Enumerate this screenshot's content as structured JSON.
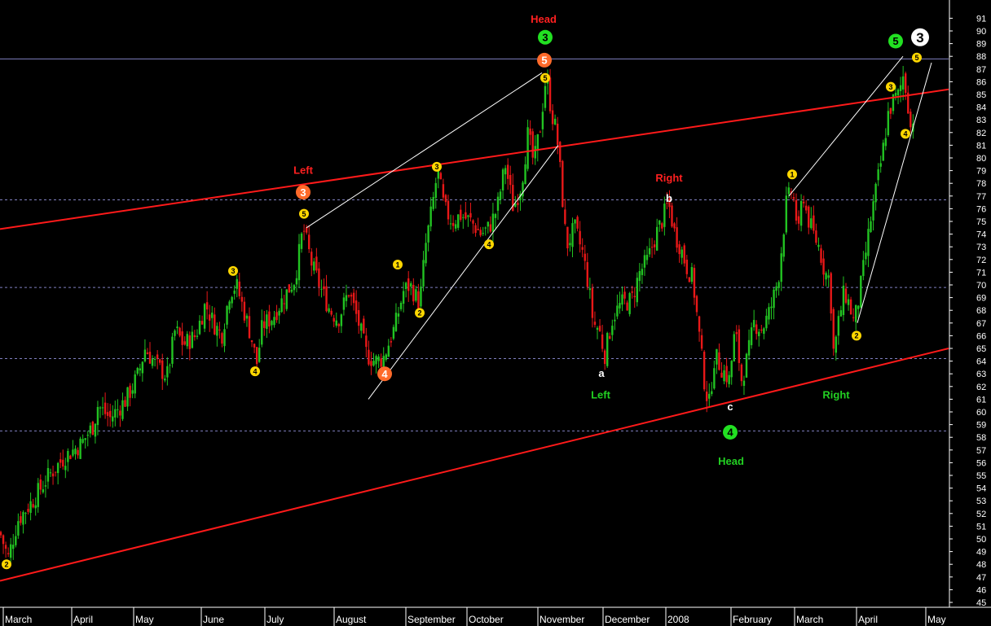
{
  "chart_data": {
    "type": "candlestick",
    "title": "",
    "xlabel": "",
    "ylabel": "",
    "ylim": [
      45,
      92
    ],
    "y_ticks": [
      45,
      46,
      47,
      48,
      49,
      50,
      51,
      52,
      53,
      54,
      55,
      56,
      57,
      58,
      59,
      60,
      61,
      62,
      63,
      64,
      65,
      66,
      67,
      68,
      69,
      70,
      71,
      72,
      73,
      74,
      75,
      76,
      77,
      78,
      79,
      80,
      81,
      82,
      83,
      84,
      85,
      86,
      87,
      88,
      89,
      90,
      91
    ],
    "x_ticks": [
      "March",
      "April",
      "May",
      "June",
      "July",
      "August",
      "September",
      "October",
      "November",
      "December",
      "2008",
      "February",
      "March",
      "April",
      "May"
    ],
    "grid": false,
    "reference_lines": [
      {
        "style": "dashed",
        "color": "#8080c0",
        "y": 58.5
      },
      {
        "style": "dashed",
        "color": "#8080c0",
        "y": 64.2
      },
      {
        "style": "dashed",
        "color": "#8080c0",
        "y": 69.8
      },
      {
        "style": "dashed",
        "color": "#8080c0",
        "y": 76.7
      },
      {
        "style": "solid",
        "color": "#8080c0",
        "y": 87.8
      }
    ],
    "colors": {
      "up": "#22c322",
      "down": "#e81818",
      "trend": "#ff1a1a",
      "wave": "#ffffff",
      "head": "#ff2020",
      "green_label": "#22d022",
      "yellow_marker": "#ffd700",
      "orange_marker": "#ff6a2a",
      "green_marker": "#22e022"
    },
    "price_path": [
      [
        0,
        50.5
      ],
      [
        10,
        48.5
      ],
      [
        22,
        51.5
      ],
      [
        40,
        53.0
      ],
      [
        60,
        55.0
      ],
      [
        80,
        56.5
      ],
      [
        100,
        57.5
      ],
      [
        115,
        59.0
      ],
      [
        120,
        60.5
      ],
      [
        135,
        59.5
      ],
      [
        155,
        61.0
      ],
      [
        170,
        63.0
      ],
      [
        178,
        65.0
      ],
      [
        190,
        63.8
      ],
      [
        205,
        62.8
      ],
      [
        215,
        66.5
      ],
      [
        225,
        65.3
      ],
      [
        240,
        66.0
      ],
      [
        252,
        68.5
      ],
      [
        262,
        67.0
      ],
      [
        272,
        66.0
      ],
      [
        282,
        69.5
      ],
      [
        290,
        70.0
      ],
      [
        300,
        67.8
      ],
      [
        308,
        66.0
      ],
      [
        315,
        63.8
      ],
      [
        322,
        66.8
      ],
      [
        335,
        67.5
      ],
      [
        348,
        69.0
      ],
      [
        362,
        70.5
      ],
      [
        372,
        74.5
      ],
      [
        383,
        71.5
      ],
      [
        395,
        69.5
      ],
      [
        405,
        68.0
      ],
      [
        415,
        67.3
      ],
      [
        428,
        69.5
      ],
      [
        440,
        67.0
      ],
      [
        450,
        64.5
      ],
      [
        460,
        64.0
      ],
      [
        470,
        64.2
      ],
      [
        485,
        66.8
      ],
      [
        495,
        69.5
      ],
      [
        503,
        70.0
      ],
      [
        515,
        68.5
      ],
      [
        522,
        73.0
      ],
      [
        530,
        76.0
      ],
      [
        537,
        79.0
      ],
      [
        545,
        76.0
      ],
      [
        555,
        75.0
      ],
      [
        565,
        75.5
      ],
      [
        578,
        75.0
      ],
      [
        590,
        74.0
      ],
      [
        600,
        74.5
      ],
      [
        610,
        76.0
      ],
      [
        620,
        79.5
      ],
      [
        630,
        76.0
      ],
      [
        640,
        78.0
      ],
      [
        648,
        82.0
      ],
      [
        655,
        79.5
      ],
      [
        663,
        82.5
      ],
      [
        670,
        86.5
      ],
      [
        677,
        83.5
      ],
      [
        683,
        82.0
      ],
      [
        688,
        78.5
      ],
      [
        695,
        73.0
      ],
      [
        705,
        74.5
      ],
      [
        715,
        72.5
      ],
      [
        722,
        70.0
      ],
      [
        728,
        67.0
      ],
      [
        735,
        66.5
      ],
      [
        742,
        64.5
      ],
      [
        752,
        67.5
      ],
      [
        762,
        68.5
      ],
      [
        775,
        68.8
      ],
      [
        785,
        71.0
      ],
      [
        795,
        72.0
      ],
      [
        805,
        74.0
      ],
      [
        812,
        75.0
      ],
      [
        820,
        76.5
      ],
      [
        828,
        74.0
      ],
      [
        835,
        73.0
      ],
      [
        842,
        71.5
      ],
      [
        850,
        70.5
      ],
      [
        858,
        66.0
      ],
      [
        865,
        62.0
      ],
      [
        870,
        60.5
      ],
      [
        877,
        64.5
      ],
      [
        885,
        63.5
      ],
      [
        895,
        62.5
      ],
      [
        902,
        66.5
      ],
      [
        910,
        62.5
      ],
      [
        918,
        64.5
      ],
      [
        925,
        67.0
      ],
      [
        935,
        66.5
      ],
      [
        945,
        68.0
      ],
      [
        955,
        70.5
      ],
      [
        965,
        76.5
      ],
      [
        972,
        77.5
      ],
      [
        980,
        74.0
      ],
      [
        985,
        77.5
      ],
      [
        990,
        75.5
      ],
      [
        998,
        74.0
      ],
      [
        1005,
        73.0
      ],
      [
        1012,
        71.0
      ],
      [
        1018,
        70.5
      ],
      [
        1023,
        64.5
      ],
      [
        1030,
        67.5
      ],
      [
        1036,
        69.5
      ],
      [
        1042,
        68.5
      ],
      [
        1048,
        67.0
      ],
      [
        1054,
        69.0
      ],
      [
        1060,
        71.5
      ],
      [
        1068,
        75.0
      ],
      [
        1075,
        77.5
      ],
      [
        1082,
        80.0
      ],
      [
        1090,
        83.5
      ],
      [
        1096,
        84.5
      ],
      [
        1103,
        85.0
      ],
      [
        1108,
        86.5
      ],
      [
        1113,
        85.0
      ],
      [
        1118,
        82.0
      ],
      [
        1122,
        84.0
      ]
    ],
    "trend_lines": [
      {
        "color": "#ff1a1a",
        "from": [
          0,
          74.4
        ],
        "to": [
          1164,
          85.4
        ]
      },
      {
        "color": "#ff1a1a",
        "from": [
          0,
          46.7
        ],
        "to": [
          1164,
          65.0
        ]
      }
    ],
    "wave_channels": [
      {
        "color": "#ffffff",
        "points": [
          [
            376,
            74.5
          ],
          [
            665,
            86.7
          ]
        ]
      },
      {
        "color": "#ffffff",
        "points": [
          [
            452,
            61.0
          ],
          [
            685,
            81.0
          ]
        ]
      },
      {
        "color": "#ffffff",
        "points": [
          [
            968,
            77.0
          ],
          [
            1108,
            88.0
          ]
        ]
      },
      {
        "color": "#ffffff",
        "points": [
          [
            1052,
            67.0
          ],
          [
            1143,
            87.5
          ]
        ]
      }
    ],
    "wave_markers": [
      {
        "label": "2",
        "x": 8,
        "y": 48.0,
        "style": "yellow",
        "size": "small"
      },
      {
        "label": "3",
        "x": 286,
        "y": 71.1,
        "style": "yellow",
        "size": "small"
      },
      {
        "label": "4",
        "x": 313,
        "y": 63.2,
        "style": "yellow",
        "size": "small"
      },
      {
        "label": "5",
        "x": 373,
        "y": 75.6,
        "style": "yellow",
        "size": "small"
      },
      {
        "label": "3",
        "x": 372,
        "y": 77.3,
        "style": "orange",
        "size": "large"
      },
      {
        "label": "4",
        "x": 472,
        "y": 63.0,
        "style": "orange",
        "size": "large"
      },
      {
        "label": "1",
        "x": 488,
        "y": 71.6,
        "style": "yellow",
        "size": "small"
      },
      {
        "label": "2",
        "x": 515,
        "y": 67.8,
        "style": "yellow",
        "size": "small"
      },
      {
        "label": "3",
        "x": 536,
        "y": 79.3,
        "style": "yellow",
        "size": "small"
      },
      {
        "label": "4",
        "x": 600,
        "y": 73.2,
        "style": "yellow",
        "size": "small"
      },
      {
        "label": "5",
        "x": 669,
        "y": 86.3,
        "style": "yellow",
        "size": "small"
      },
      {
        "label": "5",
        "x": 668,
        "y": 87.7,
        "style": "orange",
        "size": "large"
      },
      {
        "label": "3",
        "x": 669,
        "y": 89.5,
        "style": "green",
        "size": "large"
      },
      {
        "label": "4",
        "x": 896,
        "y": 58.4,
        "style": "green",
        "size": "large"
      },
      {
        "label": "1",
        "x": 972,
        "y": 78.7,
        "style": "yellow",
        "size": "small"
      },
      {
        "label": "2",
        "x": 1051,
        "y": 66.0,
        "style": "yellow",
        "size": "small"
      },
      {
        "label": "3",
        "x": 1093,
        "y": 85.6,
        "style": "yellow",
        "size": "small"
      },
      {
        "label": "4",
        "x": 1111,
        "y": 81.9,
        "style": "yellow",
        "size": "small"
      },
      {
        "label": "5",
        "x": 1125,
        "y": 87.9,
        "style": "yellow",
        "size": "small"
      },
      {
        "label": "5",
        "x": 1099,
        "y": 89.2,
        "style": "green",
        "size": "large"
      },
      {
        "label": "3",
        "x": 1129,
        "y": 89.5,
        "style": "white",
        "size": "xlarge"
      }
    ],
    "annotations": [
      {
        "text": "Head",
        "x": 667,
        "y": 90.9,
        "color": "#ff2020"
      },
      {
        "text": "Left",
        "x": 372,
        "y": 79.0,
        "color": "#ff2020"
      },
      {
        "text": "Right",
        "x": 821,
        "y": 78.4,
        "color": "#ff2020"
      },
      {
        "text": "b",
        "x": 821,
        "y": 76.8,
        "color": "#ffffff"
      },
      {
        "text": "a",
        "x": 738,
        "y": 63.0,
        "color": "#ffffff"
      },
      {
        "text": "Left",
        "x": 737,
        "y": 61.3,
        "color": "#22d022"
      },
      {
        "text": "c",
        "x": 896,
        "y": 60.4,
        "color": "#ffffff"
      },
      {
        "text": "Head",
        "x": 897,
        "y": 56.1,
        "color": "#22d022"
      },
      {
        "text": "Right",
        "x": 1026,
        "y": 61.3,
        "color": "#22d022"
      }
    ]
  }
}
